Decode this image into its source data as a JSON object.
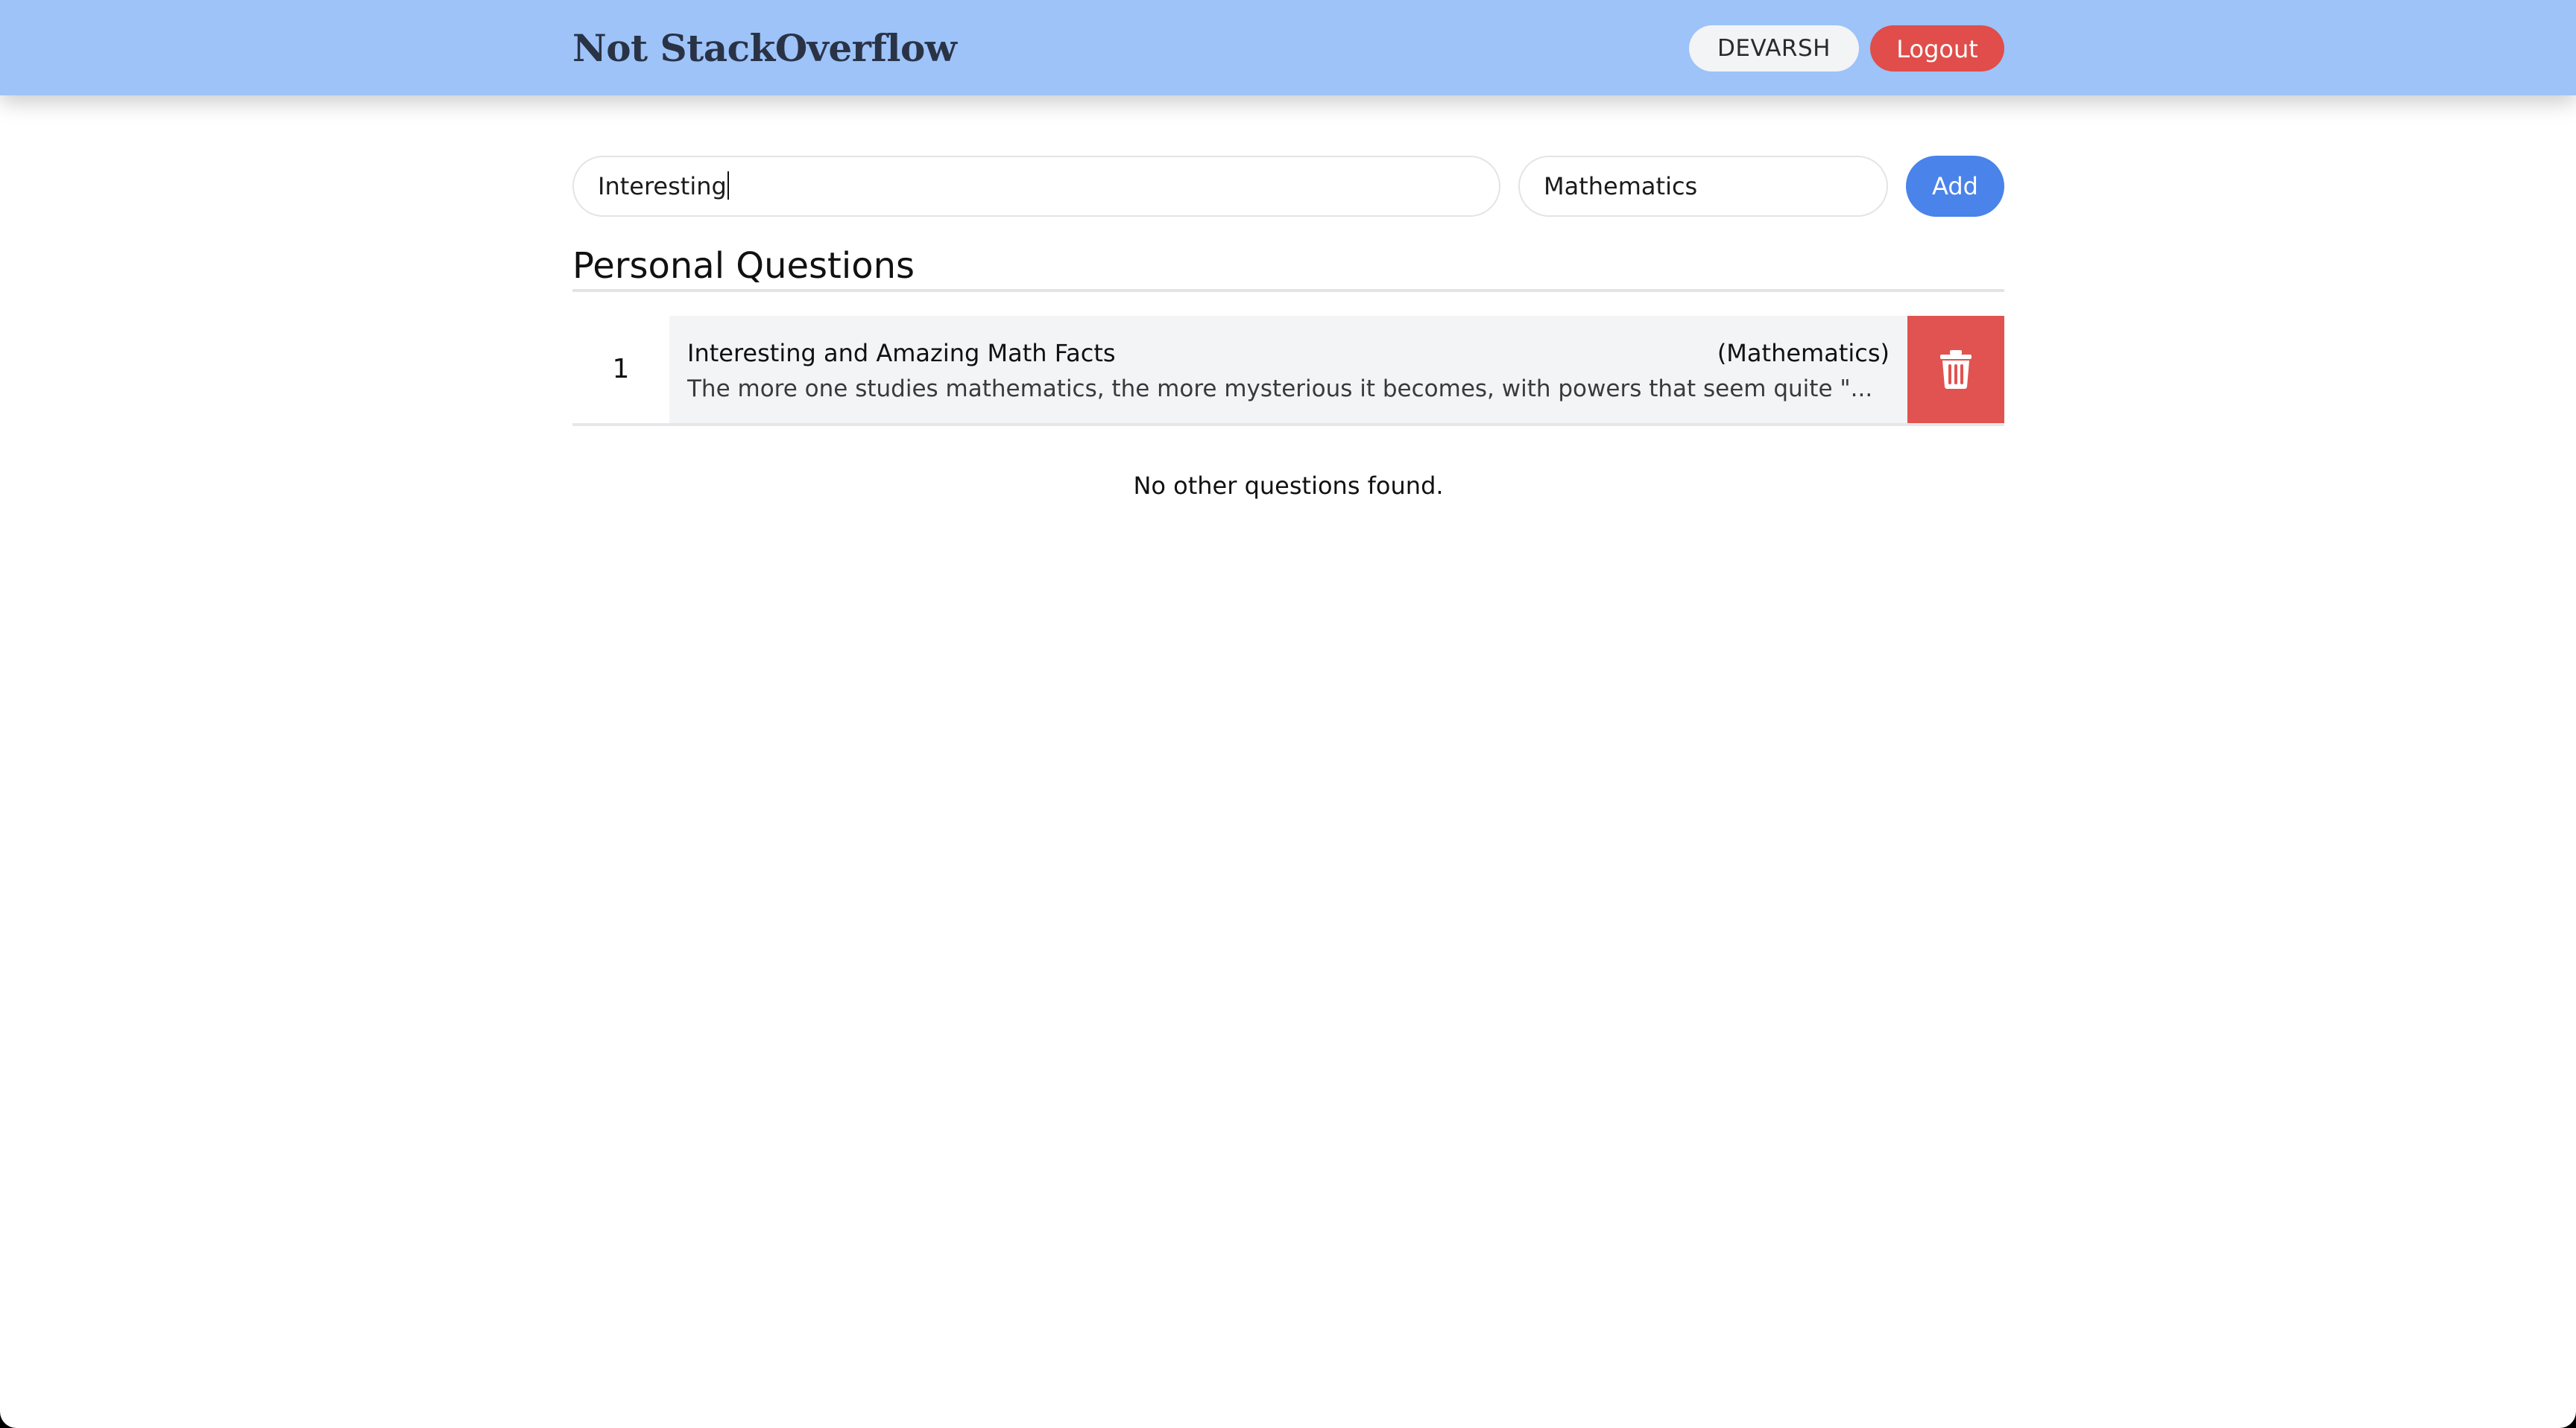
{
  "header": {
    "brand": "Not StackOverflow",
    "username": "DEVARSH",
    "logout_label": "Logout"
  },
  "form": {
    "title_value": "Interesting",
    "tag_value": "Mathematics",
    "add_label": "Add"
  },
  "section": {
    "title": "Personal Questions"
  },
  "questions": [
    {
      "index": "1",
      "title": "Interesting and Amazing Math Facts",
      "tag": "(Mathematics)",
      "description": "The more one studies mathematics, the more mysterious it becomes, with powers that seem quite \"...",
      "delete_icon": "trash-icon"
    }
  ],
  "empty_message": "No other questions found.",
  "colors": {
    "navbar": "#9dc3f8",
    "brand_text": "#2a3346",
    "logout": "#e04d4a",
    "add": "#4a83e9",
    "delete": "#e05350"
  }
}
